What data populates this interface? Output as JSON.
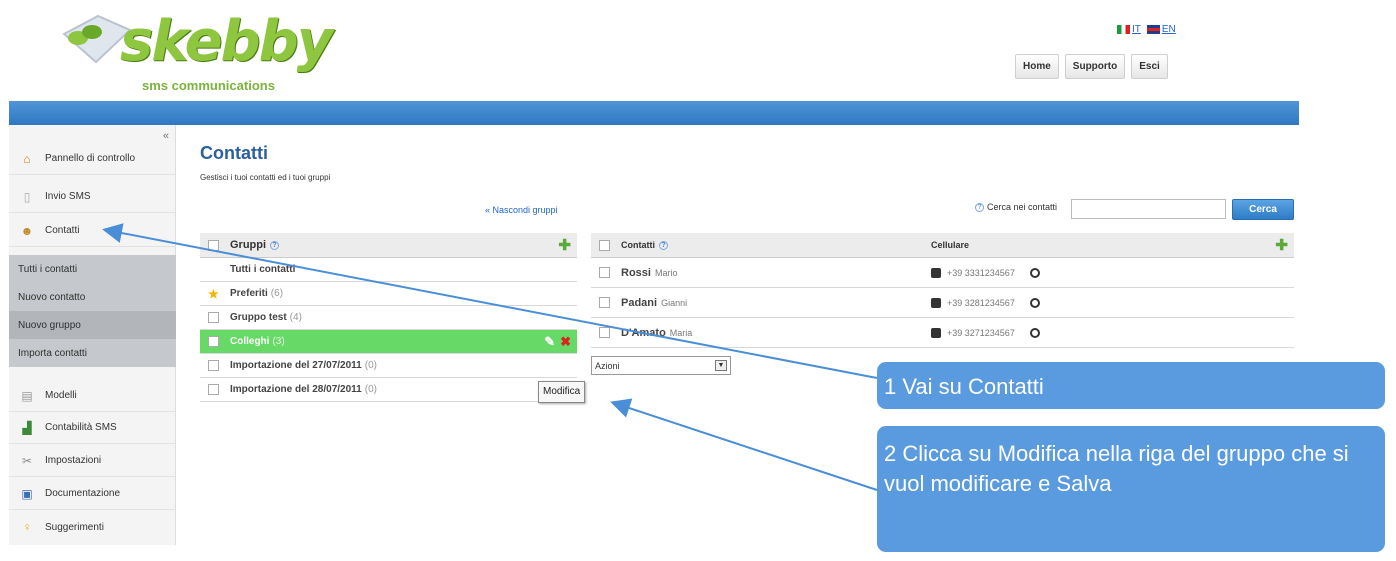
{
  "header": {
    "logo_text": "skebby",
    "logo_subtitle": "sms communications",
    "languages": [
      {
        "code": "IT",
        "label": "IT"
      },
      {
        "code": "EN",
        "label": "EN"
      }
    ],
    "nav": [
      {
        "label": "Home"
      },
      {
        "label": "Supporto"
      },
      {
        "label": "Esci"
      }
    ]
  },
  "sidebar": {
    "collapse_label": "«",
    "items": [
      {
        "label": "Pannello di controllo",
        "icon": "home-icon"
      },
      {
        "label": "Invio SMS",
        "icon": "document-icon"
      },
      {
        "label": "Contatti",
        "icon": "contacts-icon"
      },
      {
        "label": "Modelli",
        "icon": "templates-icon"
      },
      {
        "label": "Contabilità SMS",
        "icon": "bar-chart-icon"
      },
      {
        "label": "Impostazioni",
        "icon": "tools-icon"
      },
      {
        "label": "Documentazione",
        "icon": "book-icon"
      },
      {
        "label": "Suggerimenti",
        "icon": "lightbulb-icon"
      }
    ],
    "submenu": [
      {
        "label": "Tutti i contatti"
      },
      {
        "label": "Nuovo contatto"
      },
      {
        "label": "Nuovo gruppo"
      },
      {
        "label": "Importa contatti"
      }
    ]
  },
  "main": {
    "title": "Contatti",
    "subtitle": "Gestisci i tuoi contatti ed i tuoi gruppi",
    "hide_groups_link": "« Nascondi gruppi",
    "search": {
      "label": "Cerca nei contatti",
      "value": "",
      "button": "Cerca"
    },
    "groups": {
      "header": "Gruppi",
      "rows": [
        {
          "name": "Tutti i contatti",
          "count": ""
        },
        {
          "name": "Preferiti",
          "count": "(6)"
        },
        {
          "name": "Gruppo test",
          "count": "(4)"
        },
        {
          "name": "Colleghi",
          "count": "(3)"
        },
        {
          "name": "Importazione del 27/07/2011",
          "count": "(0)"
        },
        {
          "name": "Importazione del 28/07/2011",
          "count": "(0)"
        }
      ]
    },
    "contacts": {
      "header_name": "Contatti",
      "header_phone": "Cellulare",
      "rows": [
        {
          "last": "Rossi",
          "first": "Mario",
          "phone": "+39 3331234567"
        },
        {
          "last": "Padani",
          "first": "Gianni",
          "phone": "+39 3281234567"
        },
        {
          "last": "D'Amato",
          "first": "Maria",
          "phone": "+39 3271234567"
        }
      ]
    },
    "actions_select": "Azioni",
    "tooltip": "Modifica"
  },
  "callouts": {
    "step1": "1 Vai su Contatti",
    "step2": "2 Clicca su Modifica nella riga del gruppo che si vuol modificare e Salva"
  },
  "colors": {
    "brand_blue": "#2f78c2",
    "brand_green": "#8ec63f",
    "selected_row": "#66d966",
    "callout": "#5a9be0"
  }
}
